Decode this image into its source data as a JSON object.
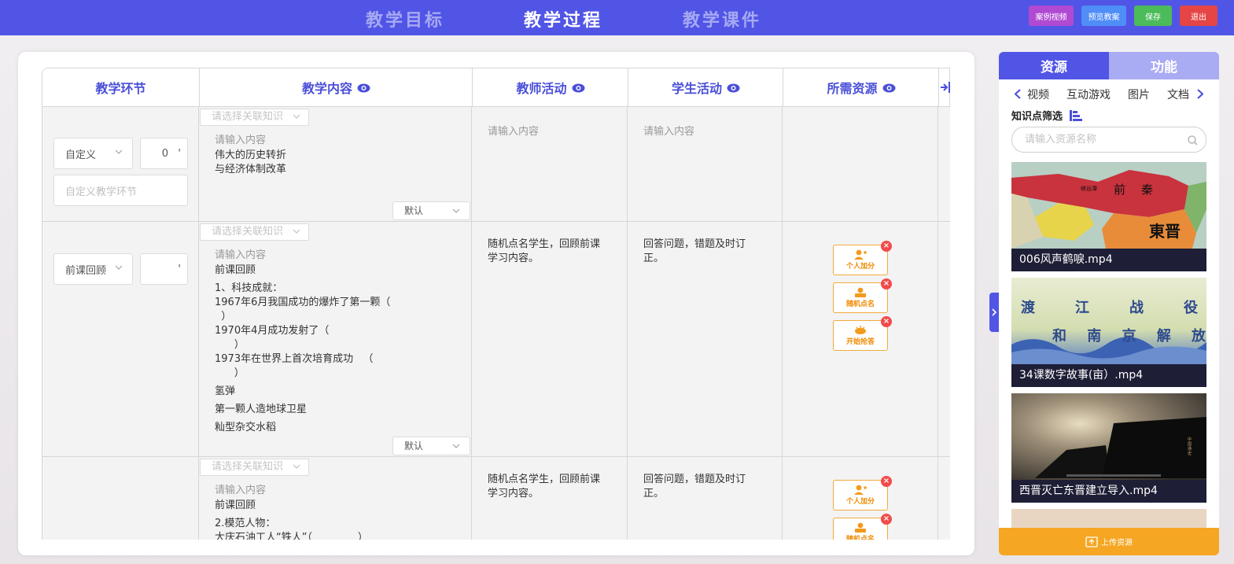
{
  "topbar": {
    "tabs": [
      {
        "label": "教学目标"
      },
      {
        "label": "教学过程"
      },
      {
        "label": "教学课件"
      }
    ],
    "buttons": [
      {
        "label": "案例视频",
        "color": "#b04ad3"
      },
      {
        "label": "预览教案",
        "color": "#4f8ef7"
      },
      {
        "label": "保存",
        "color": "#4cbb5a"
      },
      {
        "label": "退出",
        "color": "#e64545"
      }
    ]
  },
  "table": {
    "headers": [
      {
        "label": "教学环节",
        "eye": false
      },
      {
        "label": "教学内容",
        "eye": true
      },
      {
        "label": "教师活动",
        "eye": true
      },
      {
        "label": "学生活动",
        "eye": true
      },
      {
        "label": "所需资源",
        "eye": true
      }
    ],
    "knowledge_placeholder": "请选择关联知识",
    "content_placeholder": "请输入内容",
    "custom_stage_placeholder": "自定义教学环节",
    "default_label": "默认",
    "rows": [
      {
        "stage": "自定义",
        "minutes": "0",
        "minutes_suffix": "'",
        "content": "伟大的历史转折\n与经济体制改革",
        "teacher": "请输入内容",
        "student": "请输入内容"
      },
      {
        "stage": "前课回顾",
        "minutes": "",
        "minutes_suffix": "'",
        "content_lines": [
          "前课回顾",
          "1、科技成就：",
          "1967年6月我国成功的爆炸了第一颗（\n  ）",
          "1970年4月成功发射了（\n      ）",
          "1973年在世界上首次培育成功   （\n      ）",
          "氢弹",
          "第一颗人造地球卫星",
          "籼型杂交水稻"
        ],
        "teacher": "随机点名学生，回顾前课\n学习内容。",
        "student": "回答问题，错题及时订\n正。",
        "resources": [
          "个人加分",
          "随机点名",
          "开始抢答"
        ]
      },
      {
        "content_lines": [
          "前课回顾",
          "2.模范人物：",
          "大庆石油工人“铁人”（              ）"
        ],
        "teacher": "随机点名学生，回顾前课\n学习内容。",
        "student": "回答问题，错题及时订\n正。",
        "resources": [
          "个人加分",
          "随机点名"
        ]
      }
    ]
  },
  "panel": {
    "tabs": [
      {
        "label": "资源"
      },
      {
        "label": "功能"
      }
    ],
    "categories": [
      "视频",
      "互动游戏",
      "图片",
      "文档"
    ],
    "filter_label": "知识点筛选",
    "search_placeholder": "请输入资源名称",
    "videos": [
      {
        "title": "006风声鹤唳.mp4",
        "map_label_1": "前",
        "map_label_2": "秦",
        "map_label_3": "東晋",
        "map_small": "峡谷潭"
      },
      {
        "title": "34课数字故事(亩）.mp4",
        "banner_line_1": [
          "渡",
          "江",
          "战",
          "役"
        ],
        "banner_line_2": [
          "和",
          "南",
          "京",
          "解",
          "放"
        ]
      },
      {
        "title": "西晋灭亡东晋建立导入.mp4",
        "vertical_text": "中国通史"
      }
    ],
    "upload_label": "上传资源"
  },
  "colors": {
    "primary": "#5155e6",
    "accent": "#f5a623"
  }
}
